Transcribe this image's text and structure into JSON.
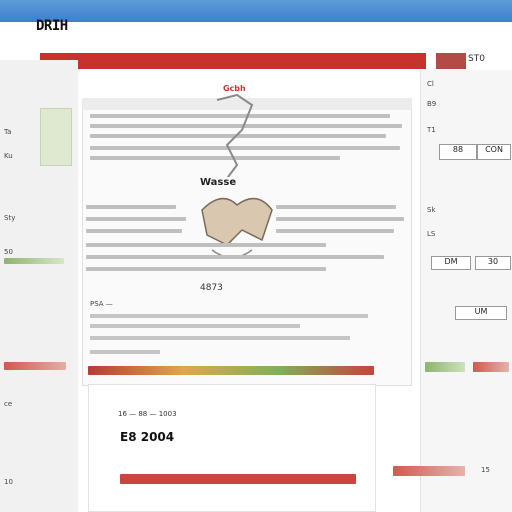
{
  "window": {
    "app_title": "DRIH",
    "top_right": "ST0"
  },
  "article": {
    "title": "Gcbh",
    "figure_caption": "Wasse",
    "mid_number": "4873",
    "lower_row_label": "16 — 88 — 1003",
    "lower_big": "E8  2004",
    "note": "PSA —"
  },
  "sidebar": {
    "items": [
      {
        "label": "Ta"
      },
      {
        "label": "Ku"
      },
      {
        "label": "Sty"
      },
      {
        "label": "50"
      },
      {
        "label": "ce"
      },
      {
        "label": "10"
      }
    ]
  },
  "right_panel": {
    "lines": [
      "Cl",
      "B9",
      "T1",
      "Sk",
      "LS"
    ],
    "btn1": "88",
    "btn2": "CON",
    "btn3": "DM",
    "btn4": "30",
    "btn5": "UM",
    "foot": "15"
  },
  "colors": {
    "accent_red": "#c8322e",
    "title_bar": "#3d7fcf",
    "green": "#8db46e"
  }
}
